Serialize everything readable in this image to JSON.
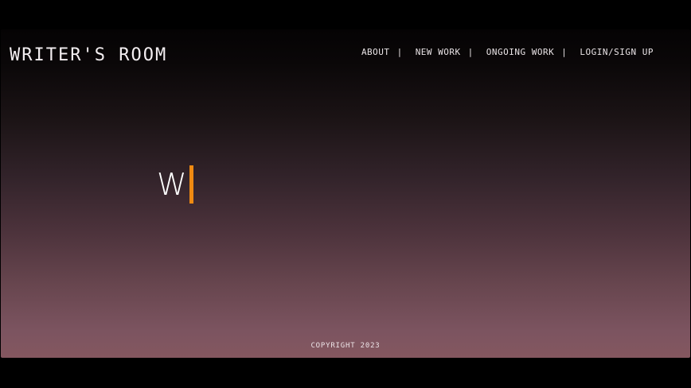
{
  "header": {
    "brand": "WRITER'S ROOM"
  },
  "nav": {
    "items": [
      {
        "label": "ABOUT",
        "separator": "|"
      },
      {
        "label": "NEW WORK",
        "separator": "|"
      },
      {
        "label": "ONGOING WORK",
        "separator": "|"
      },
      {
        "label": "LOGIN/SIGN UP",
        "separator": ""
      }
    ]
  },
  "hero": {
    "typed_text": "W",
    "caret_color": "#ef8a12"
  },
  "footer": {
    "copyright": "COPYRIGHT 2023"
  },
  "colors": {
    "background_top": "#050304",
    "background_bottom": "#84575f",
    "text": "#f3eef1",
    "accent": "#ef8a12"
  }
}
